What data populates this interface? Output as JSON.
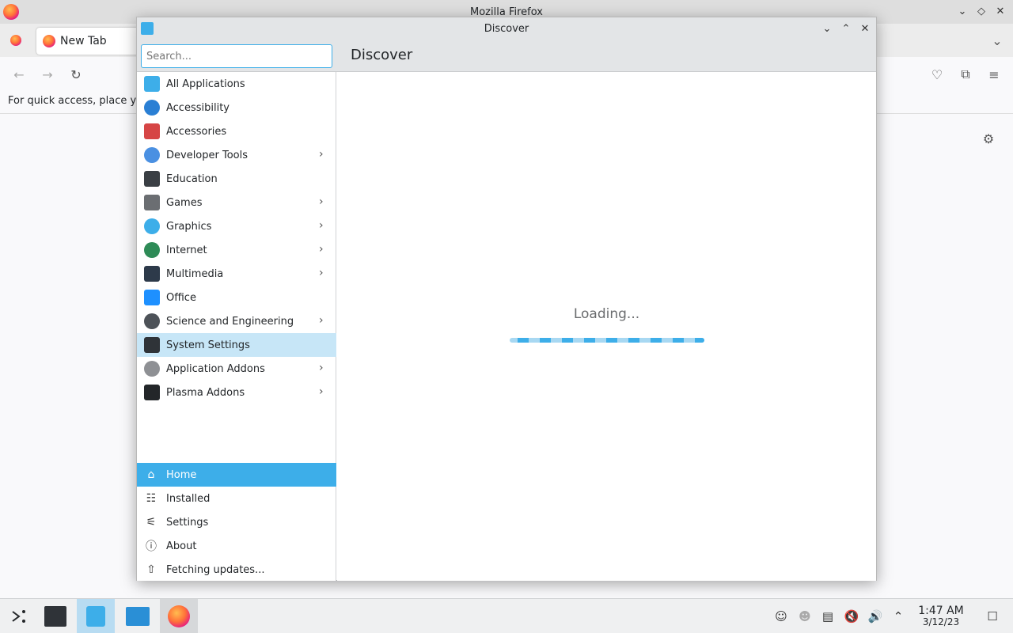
{
  "firefox": {
    "window_title": "Mozilla Firefox",
    "tab_label": "New Tab",
    "bookmarks_hint": "For quick access, place yo"
  },
  "discover": {
    "window_title": "Discover",
    "search_placeholder": "Search...",
    "page_title": "Discover",
    "loading_text": "Loading...",
    "categories": [
      {
        "label": "All Applications",
        "icon": "grid-icon",
        "color": "#3daee9",
        "has_children": false
      },
      {
        "label": "Accessibility",
        "icon": "accessibility-icon",
        "color": "#2a7fd4",
        "has_children": false
      },
      {
        "label": "Accessories",
        "icon": "toolbox-icon",
        "color": "#d64545",
        "has_children": false
      },
      {
        "label": "Developer Tools",
        "icon": "hammer-icon",
        "color": "#4a90e2",
        "has_children": true
      },
      {
        "label": "Education",
        "icon": "chalkboard-icon",
        "color": "#3a3f44",
        "has_children": false
      },
      {
        "label": "Games",
        "icon": "gamepad-icon",
        "color": "#6b6e72",
        "has_children": true
      },
      {
        "label": "Graphics",
        "icon": "sphere-icon",
        "color": "#3daee9",
        "has_children": true
      },
      {
        "label": "Internet",
        "icon": "globe-icon",
        "color": "#2e8b57",
        "has_children": true
      },
      {
        "label": "Multimedia",
        "icon": "monitor-icon",
        "color": "#2d3a4a",
        "has_children": true
      },
      {
        "label": "Office",
        "icon": "document-icon",
        "color": "#1e90ff",
        "has_children": false
      },
      {
        "label": "Science and Engineering",
        "icon": "flask-icon",
        "color": "#4d5258",
        "has_children": true
      },
      {
        "label": "System Settings",
        "icon": "settings-panel-icon",
        "color": "#2f3338",
        "has_children": false,
        "selected": true
      },
      {
        "label": "Application Addons",
        "icon": "dots-icon",
        "color": "#8e9094",
        "has_children": true
      },
      {
        "label": "Plasma Addons",
        "icon": "sparkle-icon",
        "color": "#232629",
        "has_children": true
      }
    ],
    "bottom_nav": [
      {
        "label": "Home",
        "icon": "home-icon",
        "glyph": "⌂",
        "active": true
      },
      {
        "label": "Installed",
        "icon": "installed-list-icon",
        "glyph": "☷",
        "active": false
      },
      {
        "label": "Settings",
        "icon": "sliders-icon",
        "glyph": "⚟",
        "active": false
      },
      {
        "label": "About",
        "icon": "info-icon",
        "glyph": "ⓘ",
        "active": false
      },
      {
        "label": "Fetching updates...",
        "icon": "update-arrow-icon",
        "glyph": "⇧",
        "active": false
      }
    ]
  },
  "taskbar": {
    "time": "1:47 AM",
    "date": "3/12/23"
  },
  "colors": {
    "accent": "#3daee9",
    "selected_row": "#c7e6f7",
    "titlebar": "#e3e5e7"
  }
}
